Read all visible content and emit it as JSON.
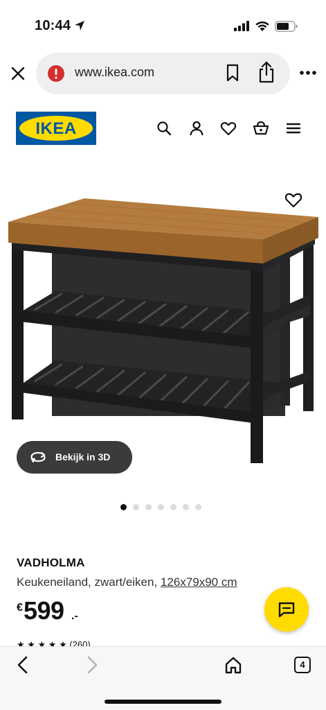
{
  "status_bar": {
    "time": "10:44",
    "icons": [
      "location-arrow-icon",
      "signal-bars-icon",
      "wifi-icon",
      "battery-icon"
    ]
  },
  "browser": {
    "url": "www.ikea.com",
    "icons": [
      "close-icon",
      "site-warning-icon",
      "bookmark-icon",
      "share-icon",
      "more-icon"
    ]
  },
  "header": {
    "logo_text": "IKEA",
    "logo_colors": {
      "blue": "#0058a3",
      "yellow": "#ffdb00"
    },
    "icons": [
      "search-icon",
      "account-icon",
      "heart-icon",
      "cart-icon",
      "menu-icon"
    ]
  },
  "gallery": {
    "view_3d_label": "Bekijk in 3D",
    "image_count": 7,
    "active_index": 0
  },
  "product": {
    "name": "VADHOLMA",
    "description": "Keukeneiland, zwart/eiken,",
    "dimensions": "126x79x90 cm",
    "price_currency": "€",
    "price_amount": "599",
    "price_decimals": ".-",
    "rating_text": "★ ★ ★ ★ ★ (260)"
  },
  "chat": {
    "icon": "chat-icon",
    "color": "#ffdb00"
  },
  "toolbar": {
    "tabs_count": "4",
    "icons": [
      "back-icon",
      "forward-icon",
      "home-icon",
      "tabs-icon"
    ]
  }
}
